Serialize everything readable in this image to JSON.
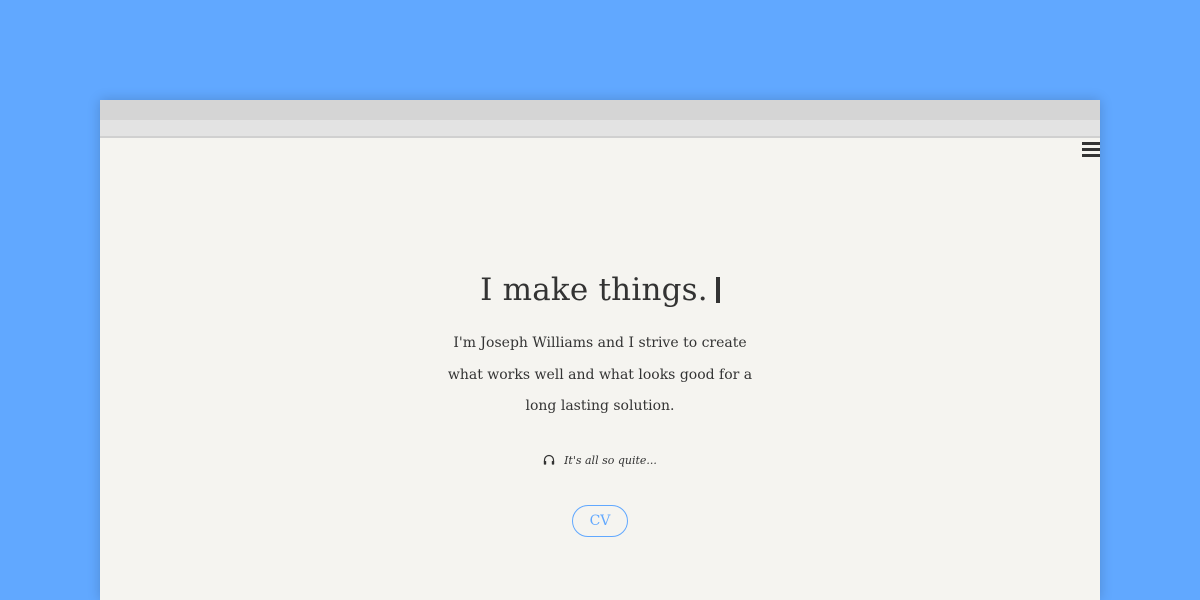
{
  "colors": {
    "background": "#61a8ff",
    "page": "#f5f4f0",
    "text": "#333333",
    "accent": "#61a8ff"
  },
  "browser": {
    "menu_icon": "hamburger-menu-icon"
  },
  "hero": {
    "headline": "I make things.",
    "intro": "I'm Joseph Williams and I strive to create what works well and what looks good for a long lasting solution.",
    "now_playing_icon": "headphones-icon",
    "now_playing": "It's all so quite...",
    "cv_label": "CV"
  }
}
